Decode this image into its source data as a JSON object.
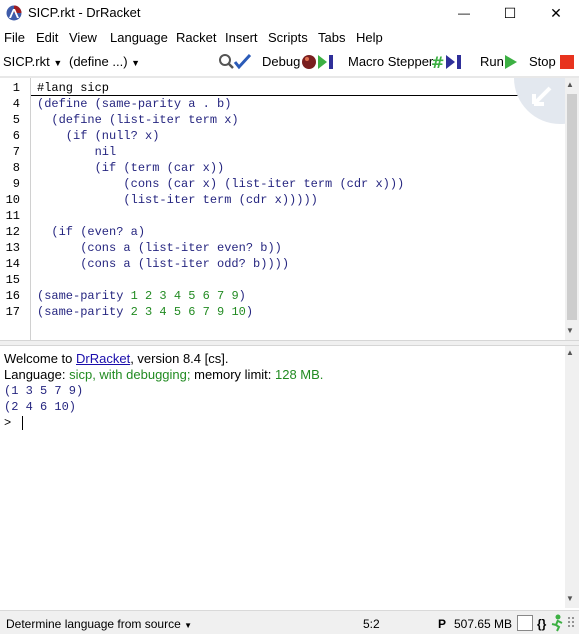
{
  "window": {
    "title": "SICP.rkt - DrRacket",
    "minimize_glyph": "—",
    "maximize_glyph": "☐",
    "close_glyph": "✕"
  },
  "menu": [
    "File",
    "Edit",
    "View",
    "Language",
    "Racket",
    "Insert",
    "Scripts",
    "Tabs",
    "Help"
  ],
  "toolbar": {
    "file_menu": "SICP.rkt",
    "define_menu": "(define ...)",
    "debug_label": "Debug",
    "macro_stepper_label": "Macro Stepper",
    "run_label": "Run",
    "stop_label": "Stop"
  },
  "editor": {
    "line_numbers": [
      "1",
      "4",
      "5",
      "6",
      "7",
      "8",
      "9",
      "10",
      "11",
      "12",
      "13",
      "14",
      "15",
      "16",
      "17"
    ],
    "lang_line": "#lang sicp",
    "lines": {
      "l4": "(define (same-parity a . b)",
      "l5": "  (define (list-iter term x)",
      "l6": "    (if (null? x)",
      "l7": "        nil",
      "l8": "        (if (term (car x))",
      "l9": "            (cons (car x) (list-iter term (cdr x)))",
      "l10": "            (list-iter term (cdr x)))))",
      "l11": "",
      "l12": "  (if (even? a)",
      "l13": "      (cons a (list-iter even? b))",
      "l14": "      (cons a (list-iter odd? b))))",
      "l15": "",
      "l16_head": "(same-parity ",
      "l16_args": "1 2 3 4 5 6 7 9",
      "l16_tail": ")",
      "l17_head": "(same-parity ",
      "l17_args": "2 3 4 5 6 7 9 10",
      "l17_tail": ")"
    }
  },
  "repl": {
    "welcome_prefix": "Welcome to ",
    "welcome_link": "DrRacket",
    "welcome_suffix": ", version 8.4 [cs].",
    "language_prefix": "Language: ",
    "language_value": "sicp, with debugging;",
    "memory_prefix": " memory limit: ",
    "memory_value": "128 MB.",
    "output_1": "(1 3 5 7 9)",
    "output_2": "(2 4 6 10)",
    "prompt": ">"
  },
  "status": {
    "language_selector": "Determine language from source",
    "position": "5:2",
    "p_indicator": "P",
    "memory": "507.65 MB",
    "braces": "{}"
  },
  "colors": {
    "code": "#262680",
    "number": "#228b22",
    "stop": "#e8331e",
    "run": "#3cb043"
  }
}
